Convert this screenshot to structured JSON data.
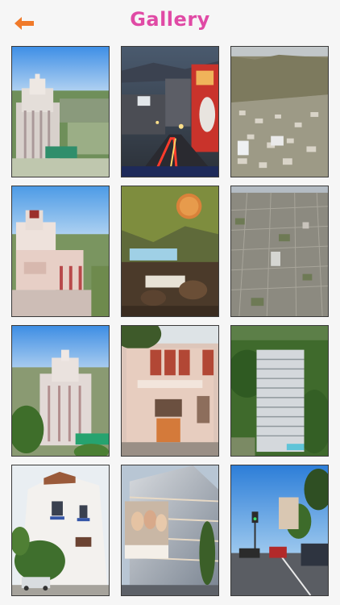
{
  "header": {
    "title": "Gallery",
    "back_icon": "back-arrow-icon",
    "accent_color": "#e04aa5",
    "back_color": "#f07a2a"
  },
  "gallery": {
    "photos": [
      {
        "subject": "art-deco-tower-city-view"
      },
      {
        "subject": "night-street-billboards"
      },
      {
        "subject": "hillside-homes-aerial"
      },
      {
        "subject": "art-deco-tower-closeup"
      },
      {
        "subject": "terrace-lounge-lanterns"
      },
      {
        "subject": "city-grid-aerial"
      },
      {
        "subject": "art-deco-tower-trees"
      },
      {
        "subject": "west-hollywood-school"
      },
      {
        "subject": "highrise-among-trees"
      },
      {
        "subject": "spanish-villa-house"
      },
      {
        "subject": "glass-building-billboard"
      },
      {
        "subject": "street-traffic-palms"
      }
    ]
  }
}
